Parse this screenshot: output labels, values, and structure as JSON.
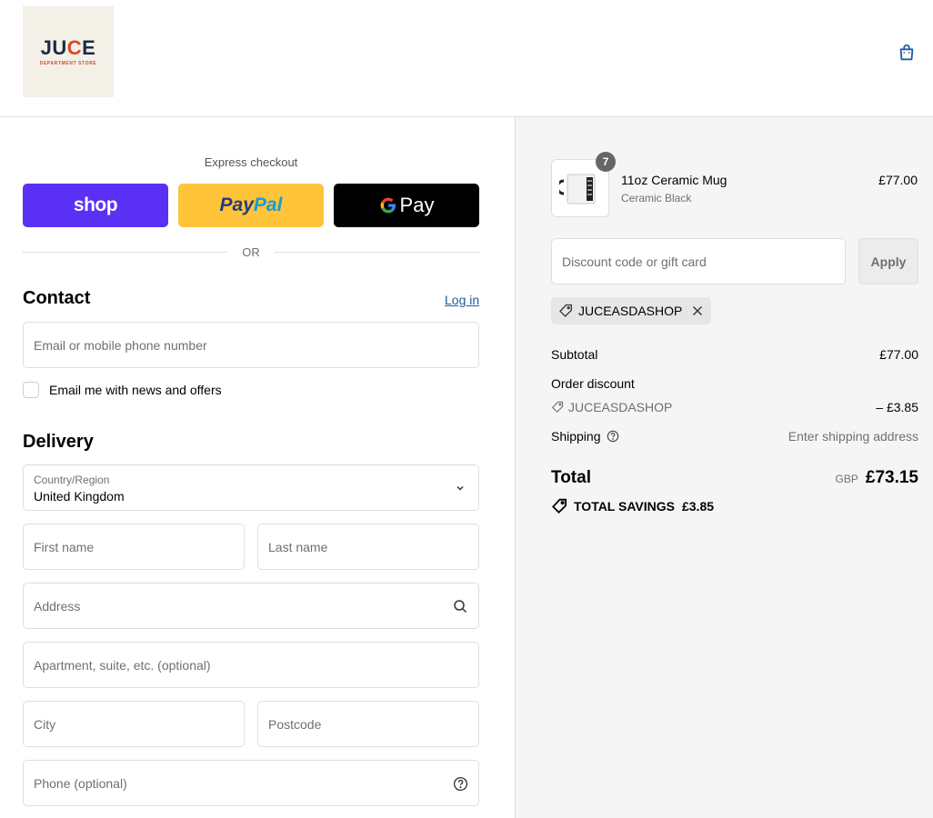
{
  "header": {
    "logo_text_prefix": "JU",
    "logo_text_o": "C",
    "logo_text_suffix": "E",
    "logo_subtext": "DEPARTMENT STORE",
    "cart_icon": "shopping-bag-icon"
  },
  "express": {
    "title": "Express checkout",
    "shop_label": "shop",
    "paypal_label_1": "Pay",
    "paypal_label_2": "Pal",
    "gpay_label": "Pay",
    "or_label": "OR"
  },
  "contact": {
    "heading": "Contact",
    "login_link": "Log in",
    "email_placeholder": "Email or mobile phone number",
    "newsletter_label": "Email me with news and offers"
  },
  "delivery": {
    "heading": "Delivery",
    "country_label": "Country/Region",
    "country_value": "United Kingdom",
    "first_name_placeholder": "First name",
    "last_name_placeholder": "Last name",
    "address_placeholder": "Address",
    "apartment_placeholder": "Apartment, suite, etc. (optional)",
    "city_placeholder": "City",
    "postcode_placeholder": "Postcode",
    "phone_placeholder": "Phone (optional)"
  },
  "order": {
    "item": {
      "quantity": "7",
      "name": "11oz Ceramic Mug",
      "variant": "Ceramic Black",
      "price": "£77.00"
    },
    "discount_placeholder": "Discount code or gift card",
    "apply_label": "Apply",
    "applied_code": "JUCEASDASHOP",
    "subtotal_label": "Subtotal",
    "subtotal_value": "£77.00",
    "order_discount_label": "Order discount",
    "discount_code": "JUCEASDASHOP",
    "discount_value": "– £3.85",
    "shipping_label": "Shipping",
    "shipping_value": "Enter shipping address",
    "total_label": "Total",
    "total_currency": "GBP",
    "total_value": "£73.15",
    "savings_label": "TOTAL SAVINGS",
    "savings_value": "£3.85"
  },
  "colors": {
    "shop_purple": "#5a31f4",
    "paypal_yellow": "#ffc439",
    "link_blue": "#1f5ba8"
  }
}
